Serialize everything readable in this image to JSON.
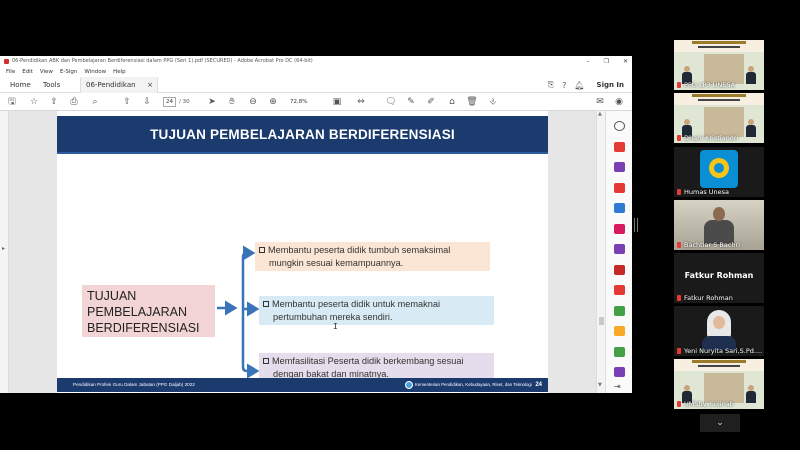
{
  "acrobat": {
    "window_title": "06-Pendidikan ABK dan Pembelajaran Berdiferensiasi dalam PPG (Seri 1).pdf (SECURED) - Adobe Acrobat Pro DC (64-bit)",
    "menu": [
      "File",
      "Edit",
      "View",
      "E-Sign",
      "Window",
      "Help"
    ],
    "tabs": {
      "home": "Home",
      "tools": "Tools",
      "doc": "06-Pendidikan ABK...",
      "doc_close": "×"
    },
    "signin": "Sign In",
    "page_current": "24",
    "page_total": "/ 30",
    "zoom": "72,8%"
  },
  "slide": {
    "title": "TUJUAN PEMBELAJARAN BERDIFERENSIASI",
    "main_box": [
      "TUJUAN",
      "PEMBELAJARAN",
      "BERDIFERENSIASI"
    ],
    "points": [
      {
        "line1": "Membantu peserta didik   tumbuh semaksimal",
        "line2": "mungkin sesuai kemampuannya."
      },
      {
        "line1": "Membantu peserta didik untuk  memaknai",
        "line2": "pertumbuhan mereka sendiri."
      },
      {
        "line1": "Memfasilitasi Peserta didik berkembang sesuai",
        "line2": "dengan bakat dan minatnya."
      }
    ],
    "footer_left": "Pendidikan Profesi Guru Dalam Jabatan (PPG Daljab) 2022",
    "footer_right": "Kementerian Pendidikan, Kebudayaan, Riset, dan Teknologi",
    "page_number": "24",
    "colors": {
      "header": "#1b3a6d",
      "main_box": "#f2d4d4",
      "point1": "#fbe6d6",
      "point2": "#d8ebf4",
      "point3": "#e5dcec",
      "arrow": "#3a73b8"
    }
  },
  "participants": [
    {
      "name": "PPG LP3 UNESA",
      "speaking": false
    },
    {
      "name": "Dhani Kristiandri",
      "speaking": true
    },
    {
      "name": "Humas Unesa",
      "speaking": false
    },
    {
      "name": "Bachtiar S Bachri",
      "speaking": false
    },
    {
      "name": "Fatkur Rohman",
      "display_name": "Fatkur Rohman",
      "speaking": false
    },
    {
      "name": "Yeni Nuryita Sari,S.Pd....",
      "speaking": false
    },
    {
      "name": "UMSby_Sujinah",
      "speaking": false
    }
  ],
  "more_participants_icon": "chevron-down-icon"
}
